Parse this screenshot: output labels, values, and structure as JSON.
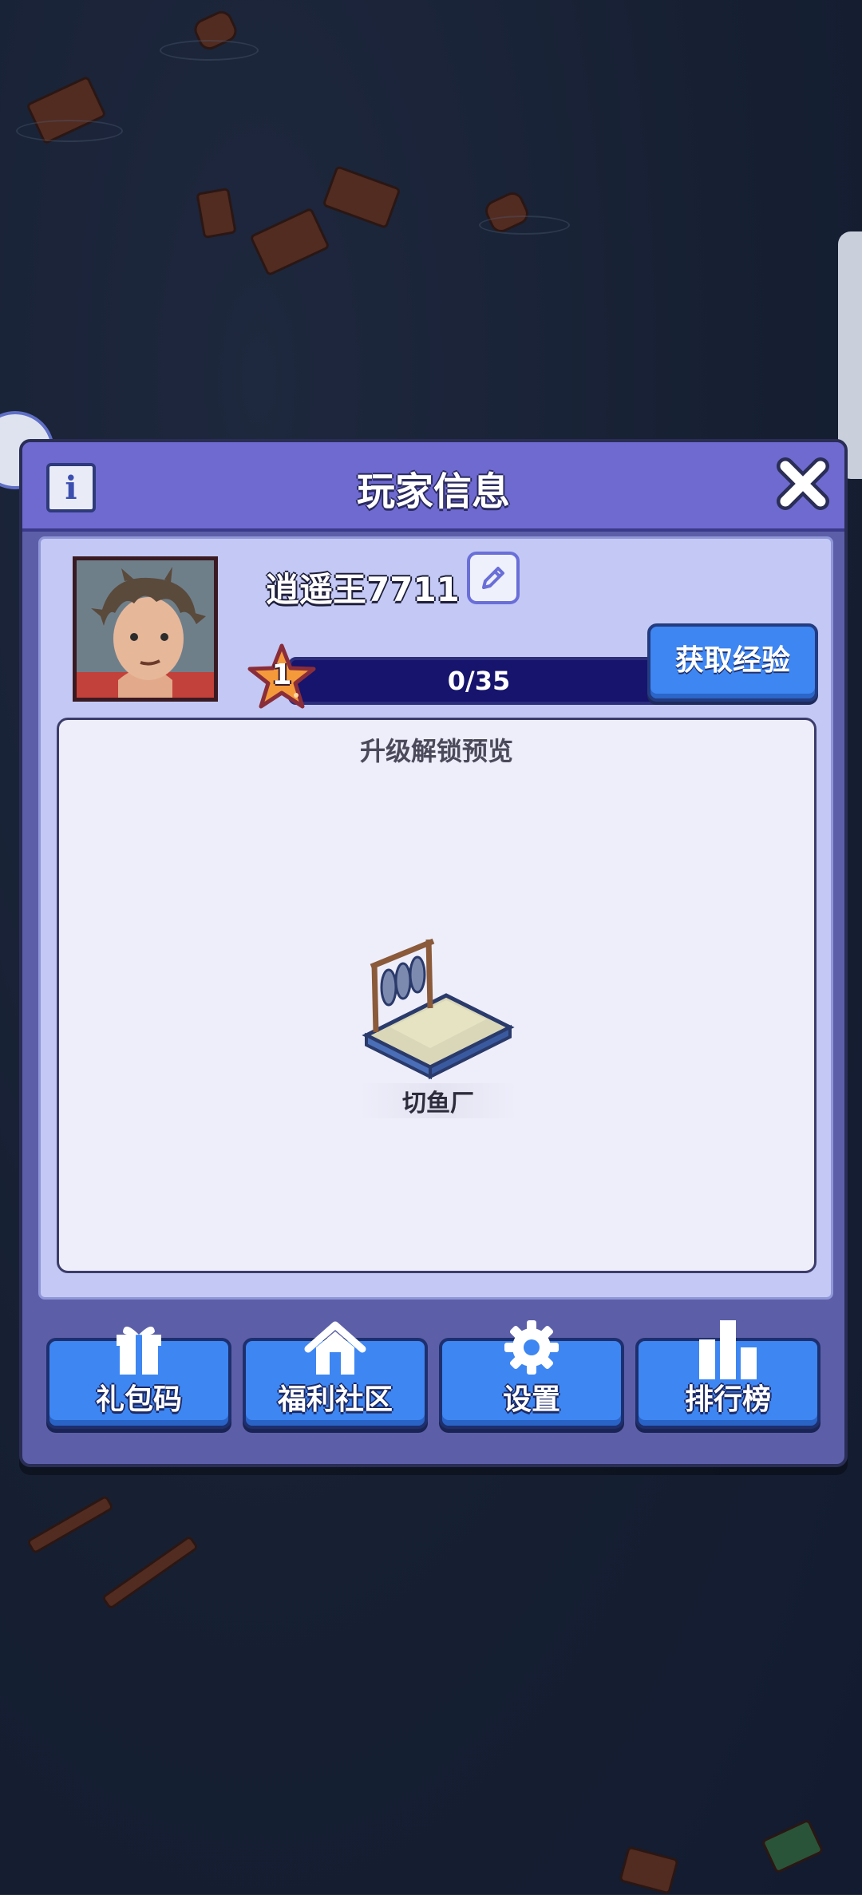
{
  "panel": {
    "title": "玩家信息",
    "info_icon": "i"
  },
  "player": {
    "name": "逍遥王7711",
    "level": "1",
    "xp_text": "0/35",
    "xp_progress": 0,
    "get_exp_label": "获取经验"
  },
  "preview": {
    "title": "升级解锁预览",
    "unlock_item": "切鱼厂"
  },
  "buttons": [
    {
      "label": "礼包码",
      "icon": "gift-icon"
    },
    {
      "label": "福利社区",
      "icon": "home-icon"
    },
    {
      "label": "设置",
      "icon": "gear-icon"
    },
    {
      "label": "排行榜",
      "icon": "leaderboard-icon"
    }
  ],
  "colors": {
    "accent_blue": "#3e86f2",
    "panel_purple": "#6e6ad0",
    "star_orange": "#f59a3a"
  }
}
